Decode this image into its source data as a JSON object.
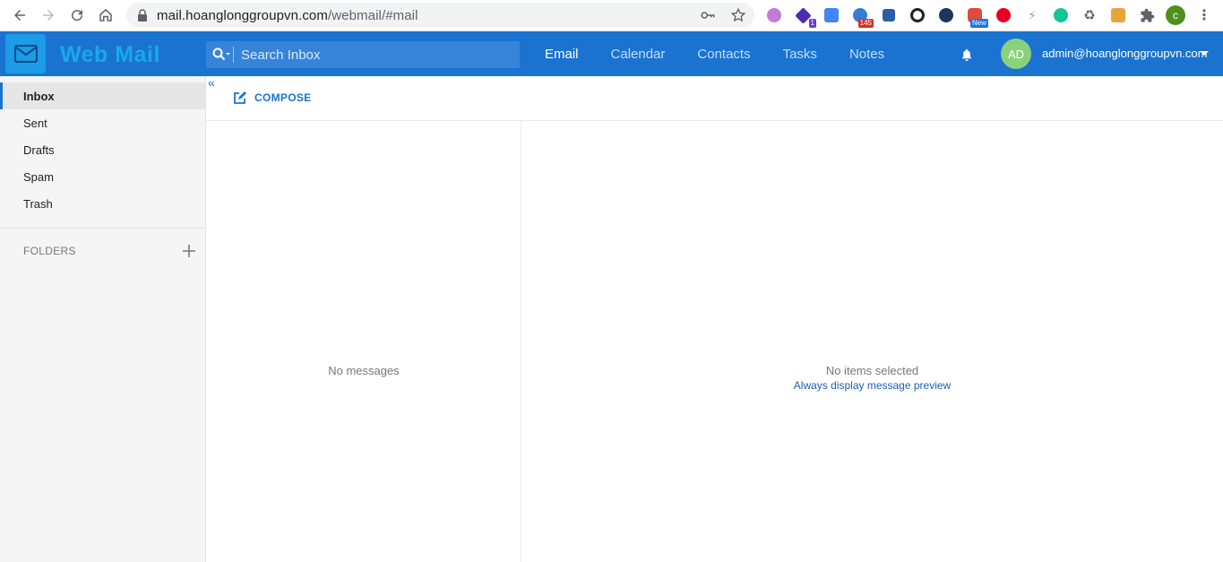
{
  "browser": {
    "url_host": "mail.hoanglonggroupvn.com",
    "url_path": "/webmail/#mail",
    "extensions": [
      {
        "name": "ext-purple-icon",
        "color": "#c27bd6",
        "badge": ""
      },
      {
        "name": "ext-graduation-icon",
        "color": "#4b2bb0",
        "badge": "1",
        "badge_color": "#6a3bd8"
      },
      {
        "name": "ext-translate-icon",
        "color": "#4285f4",
        "badge": ""
      },
      {
        "name": "ext-weather-icon",
        "color": "#3a7bd5",
        "badge": "145",
        "badge_color": "#d93025"
      },
      {
        "name": "ext-save-icon",
        "color": "#2b5ea8",
        "badge": ""
      },
      {
        "name": "ext-sync-icon",
        "color": "#222222",
        "badge": ""
      },
      {
        "name": "ext-ip-icon",
        "color": "#1d3557",
        "badge": ""
      },
      {
        "name": "ext-camera-icon",
        "color": "#e04b3c",
        "badge": "New",
        "badge_color": "#1a73e8"
      },
      {
        "name": "ext-pinterest-icon",
        "color": "#e60023",
        "badge": ""
      },
      {
        "name": "ext-bolt-icon",
        "color": "#9aa0a6",
        "badge": ""
      },
      {
        "name": "ext-grammarly-icon",
        "color": "#15c39a",
        "badge": ""
      },
      {
        "name": "ext-recycle-icon",
        "color": "#5f6368",
        "badge": ""
      },
      {
        "name": "ext-game-icon",
        "color": "#e8a33d",
        "badge": ""
      },
      {
        "name": "ext-puzzle-icon",
        "color": "#5f6368",
        "badge": ""
      }
    ],
    "profile_initial": "c"
  },
  "header": {
    "app_title": "Web Mail",
    "search_placeholder": "Search Inbox",
    "nav": [
      {
        "label": "Email",
        "active": true
      },
      {
        "label": "Calendar",
        "active": false
      },
      {
        "label": "Contacts",
        "active": false
      },
      {
        "label": "Tasks",
        "active": false
      },
      {
        "label": "Notes",
        "active": false
      }
    ],
    "avatar_initials": "AD",
    "user_email": "admin@hoanglonggroupvn.com"
  },
  "sidebar": {
    "folders": [
      {
        "label": "Inbox",
        "active": true
      },
      {
        "label": "Sent",
        "active": false
      },
      {
        "label": "Drafts",
        "active": false
      },
      {
        "label": "Spam",
        "active": false
      },
      {
        "label": "Trash",
        "active": false
      }
    ],
    "folders_header": "FOLDERS"
  },
  "toolbar": {
    "compose_label": "COMPOSE"
  },
  "message_list": {
    "empty_text": "No messages"
  },
  "preview": {
    "empty_text": "No items selected",
    "link_text": "Always display message preview"
  }
}
